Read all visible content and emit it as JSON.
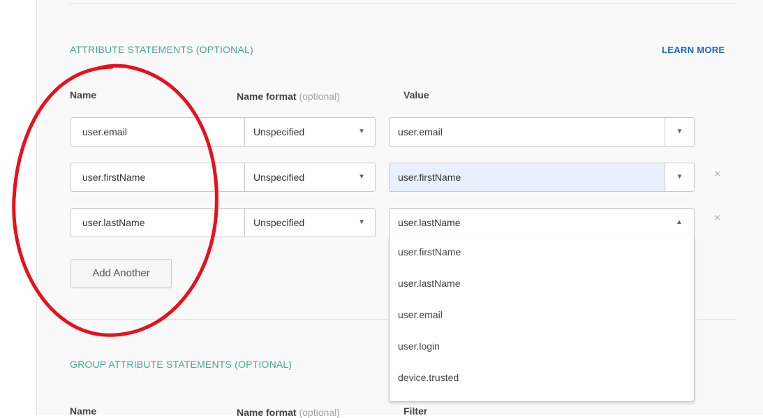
{
  "attribute_section": {
    "title": "ATTRIBUTE STATEMENTS (OPTIONAL)",
    "learn_more": "LEARN MORE",
    "columns": {
      "name": "Name",
      "name_format": "Name format",
      "name_format_hint": "(optional)",
      "value": "Value"
    },
    "rows": [
      {
        "name": "user.email",
        "format": "Unspecified",
        "value": "user.email"
      },
      {
        "name": "user.firstName",
        "format": "Unspecified",
        "value": "user.firstName"
      },
      {
        "name": "user.lastName",
        "format": "Unspecified",
        "value": "user.lastName"
      }
    ],
    "add_button": "Add Another",
    "remove_glyph": "×",
    "dropdown_options": [
      "user.firstName",
      "user.lastName",
      "user.email",
      "user.login",
      "device.trusted"
    ]
  },
  "group_section": {
    "title": "GROUP ATTRIBUTE STATEMENTS (OPTIONAL)",
    "columns": {
      "name": "Name",
      "name_format": "Name format",
      "name_format_hint": "(optional)",
      "filter": "Filter"
    }
  },
  "icons": {
    "caret_down": "▼",
    "caret_up": "▲"
  },
  "colors": {
    "section_title": "#4aa58c",
    "link": "#1662dd",
    "annotation": "#e8101a",
    "highlight_field": "#e8f0fe"
  }
}
